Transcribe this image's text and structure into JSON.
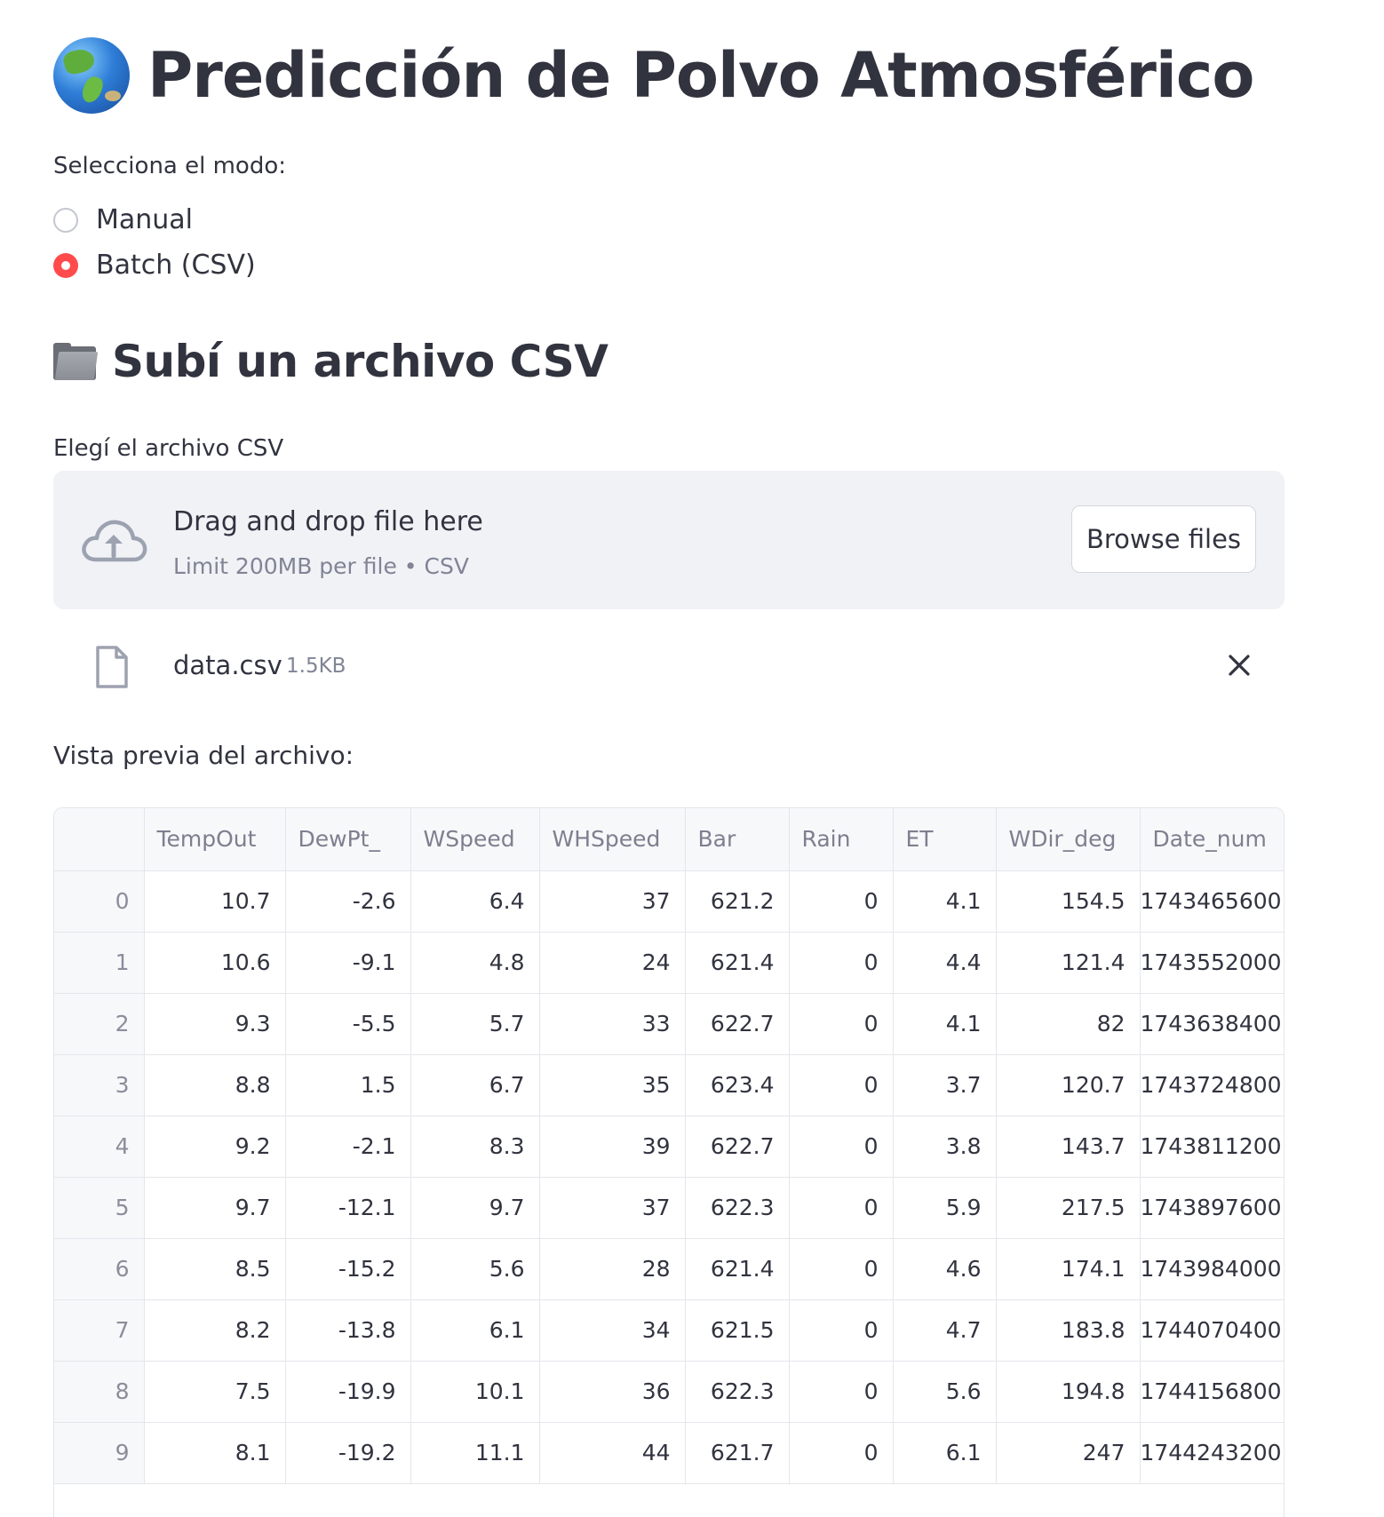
{
  "title": {
    "emoji_name": "globe-americas-icon",
    "text": "Predicción de Polvo Atmosférico"
  },
  "mode_selector": {
    "label": "Selecciona el modo:",
    "options": [
      {
        "label": "Manual",
        "selected": false
      },
      {
        "label": "Batch (CSV)",
        "selected": true
      }
    ]
  },
  "upload_section": {
    "emoji_name": "file-folder-icon",
    "header": "Subí un archivo CSV",
    "uploader_label": "Elegí el archivo CSV",
    "dropzone": {
      "title": "Drag and drop file here",
      "subtitle": "Limit 200MB per file • CSV",
      "browse_label": "Browse files"
    },
    "uploaded_file": {
      "name": "data.csv",
      "size": "1.5KB"
    }
  },
  "preview": {
    "label": "Vista previa del archivo:",
    "columns": [
      "",
      "TempOut",
      "DewPt_",
      "WSpeed",
      "WHSpeed",
      "Bar",
      "Rain",
      "ET",
      "WDir_deg",
      "Date_num"
    ],
    "rows": [
      [
        "0",
        "10.7",
        "-2.6",
        "6.4",
        "37",
        "621.2",
        "0",
        "4.1",
        "154.5",
        "1743465600"
      ],
      [
        "1",
        "10.6",
        "-9.1",
        "4.8",
        "24",
        "621.4",
        "0",
        "4.4",
        "121.4",
        "1743552000"
      ],
      [
        "2",
        "9.3",
        "-5.5",
        "5.7",
        "33",
        "622.7",
        "0",
        "4.1",
        "82",
        "1743638400"
      ],
      [
        "3",
        "8.8",
        "1.5",
        "6.7",
        "35",
        "623.4",
        "0",
        "3.7",
        "120.7",
        "1743724800"
      ],
      [
        "4",
        "9.2",
        "-2.1",
        "8.3",
        "39",
        "622.7",
        "0",
        "3.8",
        "143.7",
        "1743811200"
      ],
      [
        "5",
        "9.7",
        "-12.1",
        "9.7",
        "37",
        "622.3",
        "0",
        "5.9",
        "217.5",
        "1743897600"
      ],
      [
        "6",
        "8.5",
        "-15.2",
        "5.6",
        "28",
        "621.4",
        "0",
        "4.6",
        "174.1",
        "1743984000"
      ],
      [
        "7",
        "8.2",
        "-13.8",
        "6.1",
        "34",
        "621.5",
        "0",
        "4.7",
        "183.8",
        "1744070400"
      ],
      [
        "8",
        "7.5",
        "-19.9",
        "10.1",
        "36",
        "622.3",
        "0",
        "5.6",
        "194.8",
        "1744156800"
      ],
      [
        "9",
        "8.1",
        "-19.2",
        "11.1",
        "44",
        "621.7",
        "0",
        "6.1",
        "247",
        "1744243200"
      ]
    ]
  },
  "colors": {
    "accent": "#ff4b4b",
    "text": "#31333f",
    "muted": "#808495",
    "dropzone_bg": "#f0f2f6",
    "border": "#e4e6eb"
  }
}
